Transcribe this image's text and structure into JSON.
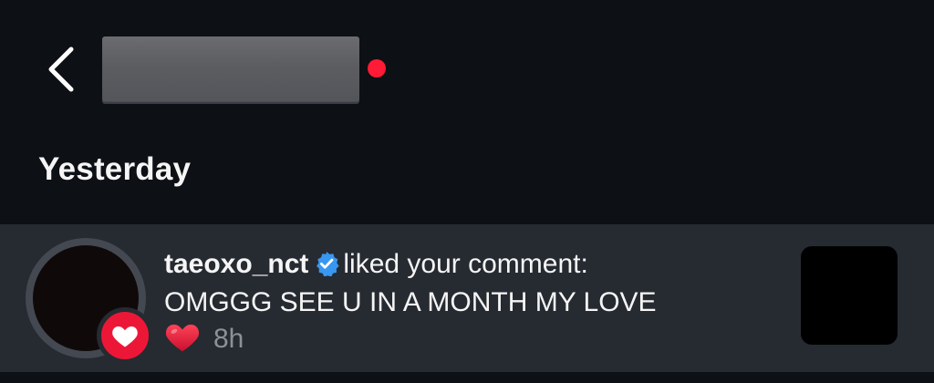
{
  "header": {
    "back_icon": "chevron-left-icon",
    "title_redacted": true,
    "unread_dot_color": "#ff1a36"
  },
  "section": {
    "title": "Yesterday"
  },
  "notification": {
    "username": "taeoxo_nct",
    "verified_icon": "verified-badge-icon",
    "action": "liked your comment:",
    "comment": "OMGGG SEE U IN A MONTH MY LOVE",
    "reaction_icon": "red-heart-emoji",
    "time": "8h",
    "badge_icon": "heart-icon",
    "badge_color": "#ec1737"
  },
  "colors": {
    "background": "#0d1014",
    "row_background": "#262a31",
    "verified": "#3897f0",
    "heart": "#e31b3d"
  }
}
